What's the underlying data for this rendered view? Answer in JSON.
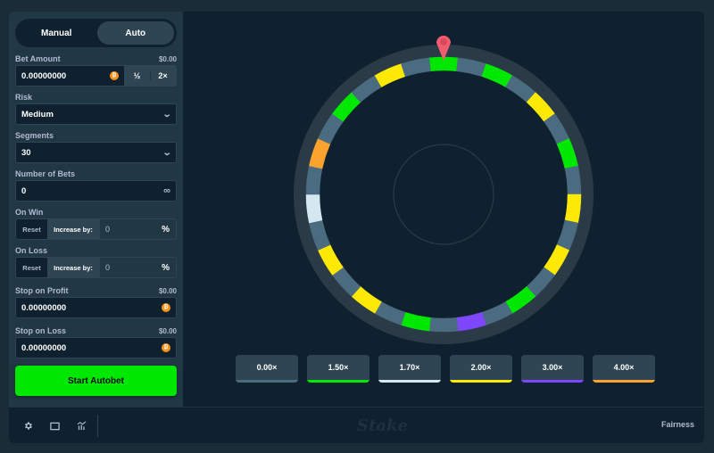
{
  "mode_toggle": {
    "options": [
      "Manual",
      "Auto"
    ],
    "active": "Auto"
  },
  "bet_amount": {
    "label": "Bet Amount",
    "usd": "$0.00",
    "value": "0.00000000",
    "currency_icon": "bitcoin-icon",
    "half_label": "½",
    "double_label": "2×"
  },
  "risk": {
    "label": "Risk",
    "value": "Medium"
  },
  "segments": {
    "label": "Segments",
    "value": "30"
  },
  "number_of_bets": {
    "label": "Number of Bets",
    "value": "0",
    "icon": "infinity-icon"
  },
  "on_win": {
    "label": "On Win",
    "reset_label": "Reset",
    "increase_label": "Increase by:",
    "value": "0",
    "unit": "%"
  },
  "on_loss": {
    "label": "On Loss",
    "reset_label": "Reset",
    "increase_label": "Increase by:",
    "value": "0",
    "unit": "%"
  },
  "stop_on_profit": {
    "label": "Stop on Profit",
    "usd": "$0.00",
    "value": "0.00000000"
  },
  "stop_on_loss": {
    "label": "Stop on Loss",
    "usd": "$0.00",
    "value": "0.00000000"
  },
  "start_button": "Start Autobet",
  "colors": {
    "gray": "#4a6b80",
    "green": "#00e701",
    "white": "#d5e8f2",
    "yellow": "#fde905",
    "purple": "#7f47fd",
    "orange": "#fca32f",
    "pointer": "#f25c6f",
    "ring": "#2a3b47"
  },
  "wheel": {
    "segments": [
      "green",
      "gray",
      "green",
      "gray",
      "yellow",
      "gray",
      "green",
      "gray",
      "yellow",
      "gray",
      "yellow",
      "gray",
      "green",
      "gray",
      "purple",
      "gray",
      "green",
      "gray",
      "yellow",
      "gray",
      "yellow",
      "gray",
      "white",
      "gray",
      "orange",
      "gray",
      "green",
      "gray",
      "yellow",
      "gray"
    ]
  },
  "multipliers": [
    {
      "label": "0.00×",
      "color": "gray"
    },
    {
      "label": "1.50×",
      "color": "green"
    },
    {
      "label": "1.70×",
      "color": "white"
    },
    {
      "label": "2.00×",
      "color": "yellow"
    },
    {
      "label": "3.00×",
      "color": "purple"
    },
    {
      "label": "4.00×",
      "color": "orange"
    }
  ],
  "footer": {
    "icons": [
      "gear-icon",
      "theatre-mode-icon",
      "stats-icon"
    ],
    "logo": "Stake",
    "fairness_label": "Fairness"
  }
}
